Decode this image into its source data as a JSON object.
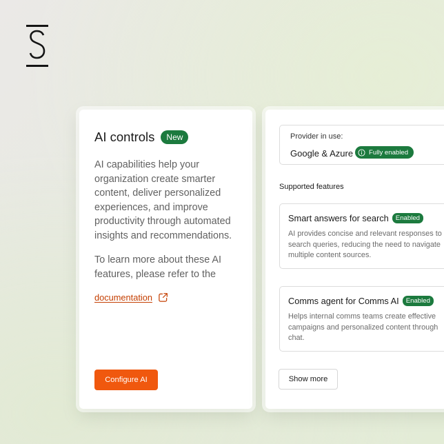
{
  "brand": {
    "logo_icon": "s-logo-icon"
  },
  "ai_controls": {
    "title": "AI controls",
    "badge": "New",
    "description": "AI capabilities help your organization create smarter content, deliver personalized experiences, and improve productivity through automated insights and recommendations.",
    "learn_more": "To learn more about these AI features, please refer to the",
    "doc_link": "documentation",
    "doc_link_icon": "external-link-icon",
    "configure_button": "Configure AI"
  },
  "provider": {
    "label": "Provider in use:",
    "name": "Google & Azure",
    "status": "Fully enabled",
    "status_icon": "info-icon"
  },
  "features": {
    "section_title": "Supported features",
    "items": [
      {
        "name": "Smart answers for search",
        "status": "Enabled",
        "description": "AI provides concise and relevant responses to search queries, reducing the need to navigate multiple content sources."
      },
      {
        "name": "Comms agent for Comms AI",
        "status": "Enabled",
        "description": "Helps internal comms teams create effective campaigns and personalized content through chat."
      }
    ],
    "show_more": "Show more"
  },
  "colors": {
    "accent": "#f0580e",
    "success": "#1c7a3e",
    "link": "#c43e00"
  }
}
